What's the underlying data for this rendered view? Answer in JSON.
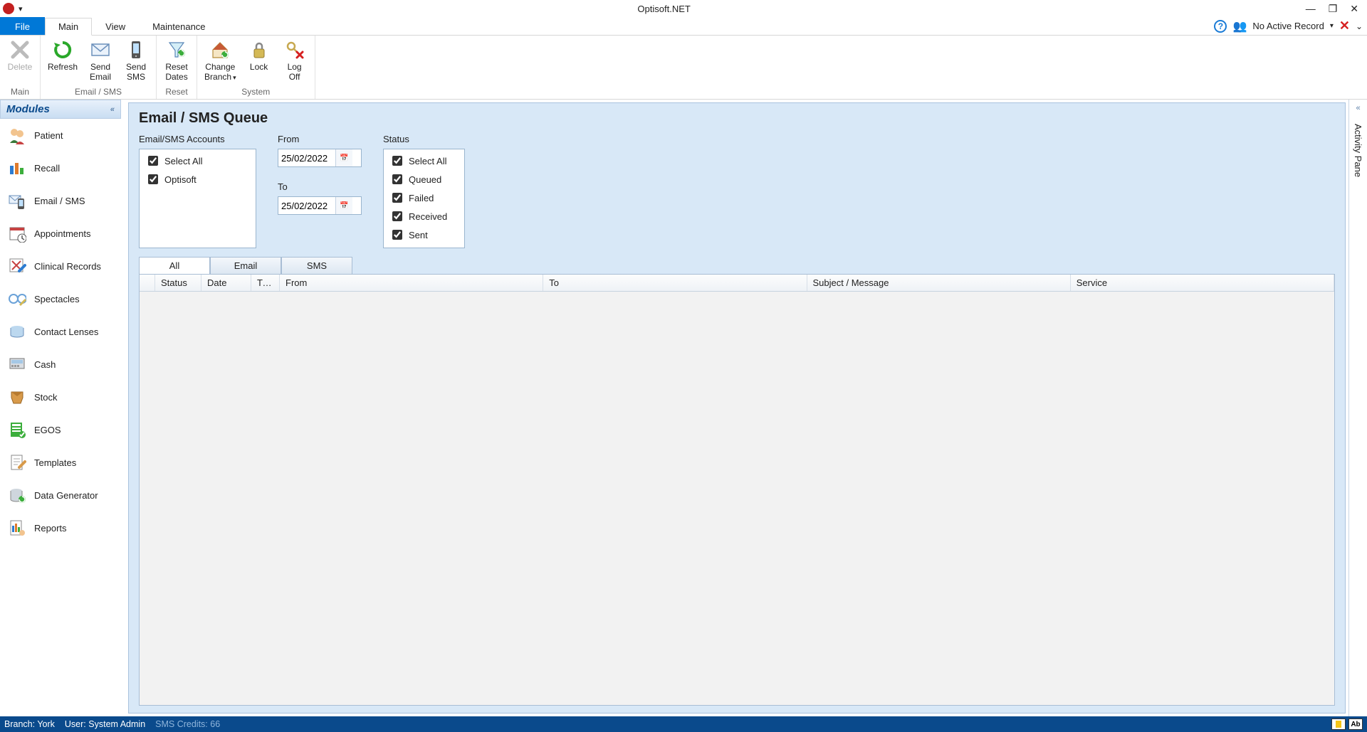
{
  "window": {
    "title": "Optisoft.NET"
  },
  "menu": {
    "file": "File",
    "tabs": [
      "Main",
      "View",
      "Maintenance"
    ],
    "active": "Main",
    "record_status": "No Active Record"
  },
  "ribbon": {
    "groups": {
      "main": {
        "label": "Main",
        "buttons": {
          "delete": "Delete"
        }
      },
      "emailsms": {
        "label": "Email / SMS",
        "buttons": {
          "refresh": "Refresh",
          "send_email": "Send\nEmail",
          "send_sms": "Send\nSMS"
        }
      },
      "reset": {
        "label": "Reset",
        "buttons": {
          "reset_dates": "Reset\nDates"
        }
      },
      "system": {
        "label": "System",
        "buttons": {
          "change_branch": "Change\nBranch",
          "lock": "Lock",
          "log_off": "Log\nOff"
        }
      }
    }
  },
  "modules": {
    "header": "Modules",
    "items": [
      {
        "label": "Patient"
      },
      {
        "label": "Recall"
      },
      {
        "label": "Email / SMS"
      },
      {
        "label": "Appointments"
      },
      {
        "label": "Clinical Records"
      },
      {
        "label": "Spectacles"
      },
      {
        "label": "Contact Lenses"
      },
      {
        "label": "Cash"
      },
      {
        "label": "Stock"
      },
      {
        "label": "EGOS"
      },
      {
        "label": "Templates"
      },
      {
        "label": "Data Generator"
      },
      {
        "label": "Reports"
      }
    ]
  },
  "main": {
    "title": "Email / SMS Queue",
    "accounts": {
      "label": "Email/SMS Accounts",
      "items": [
        {
          "label": "Select All",
          "checked": true
        },
        {
          "label": "Optisoft",
          "checked": true
        }
      ]
    },
    "from": {
      "label": "From",
      "value": "25/02/2022"
    },
    "to": {
      "label": "To",
      "value": "25/02/2022"
    },
    "status": {
      "label": "Status",
      "items": [
        {
          "label": "Select All",
          "checked": true
        },
        {
          "label": "Queued",
          "checked": true
        },
        {
          "label": "Failed",
          "checked": true
        },
        {
          "label": "Received",
          "checked": true
        },
        {
          "label": "Sent",
          "checked": true
        }
      ]
    },
    "grid_tabs": [
      "All",
      "Email",
      "SMS"
    ],
    "grid_active_tab": "All",
    "grid_columns": [
      "Status",
      "Date",
      "Time",
      "From",
      "To",
      "Subject / Message",
      "Service"
    ]
  },
  "activity_pane": {
    "label": "Activity Pane"
  },
  "status": {
    "branch_label": "Branch:",
    "branch": "York",
    "user_label": "User:",
    "user": "System Admin",
    "sms_credits_label": "SMS Credits:",
    "sms_credits": "66",
    "ab": "Ab"
  }
}
